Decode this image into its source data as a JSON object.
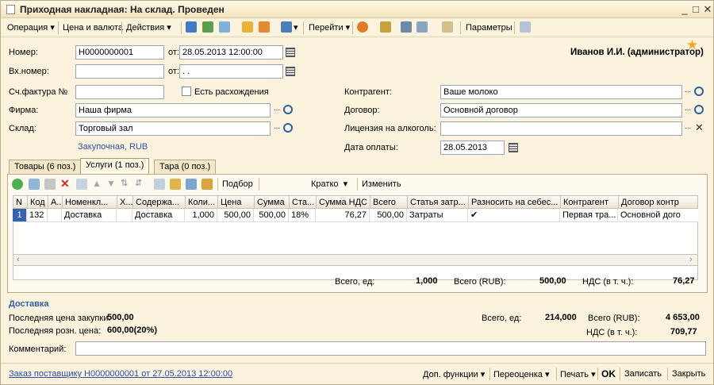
{
  "window": {
    "title": "Приходная накладная: На склад. Проведен"
  },
  "toolbar": {
    "operation": "Операция",
    "price_currency": "Цена и валюта",
    "actions": "Действия",
    "goto": "Перейти",
    "params": "Параметры"
  },
  "header": {
    "user": "Иванов И.И. (администратор)",
    "number_label": "Номер:",
    "number_value": "Н0000000001",
    "from_label": "от:",
    "date_value": "28.05.2013 12:00:00",
    "in_number_label": "Вх.номер:",
    "in_number_value": "",
    "in_from_label": "от:",
    "in_date_value": " .  .",
    "invoice_label": "Сч.фактура №",
    "invoice_value": "",
    "discrepancy_label": "Есть расхождения",
    "counterparty_label": "Контрагент:",
    "counterparty_value": "Ваше молоко",
    "firm_label": "Фирма:",
    "firm_value": "Наша фирма",
    "contract_label": "Договор:",
    "contract_value": "Основной договор",
    "warehouse_label": "Склад:",
    "warehouse_value": "Торговый зал",
    "license_label": "Лицензия на алкоголь:",
    "license_value": "",
    "price_type_link": "Закупочная, RUB",
    "pay_date_label": "Дата оплаты:",
    "pay_date_value": "28.05.2013"
  },
  "tabs": [
    {
      "label": "Товары (6 поз.)"
    },
    {
      "label": "Услуги (1 поз.)"
    },
    {
      "label": "Тара (0 поз.)"
    }
  ],
  "subtoolbar": {
    "pick": "Подбор",
    "mode": "Кратко",
    "change": "Изменить"
  },
  "grid": {
    "columns": [
      "N",
      "Код",
      "А...",
      "Номенкл...",
      "Х...",
      "Содержа...",
      "Коли...",
      "Цена",
      "Сумма",
      "Ста...",
      "Сумма НДС",
      "Всего",
      "Статья затр...",
      "Разносить на себес...",
      "Контрагент",
      "Договор контр"
    ],
    "rows": [
      [
        "1",
        "132",
        "",
        "Доставка",
        "",
        "Доставка",
        "1,000",
        "500,00",
        "500,00",
        "18%",
        "76,27",
        "500,00",
        "Затраты",
        "✔",
        "Первая тра...",
        "Основной дого"
      ]
    ]
  },
  "totals": {
    "qty_label": "Всего, ед:",
    "qty_value": "1,000",
    "sum_label": "Всего (RUB):",
    "sum_value": "500,00",
    "vat_label": "НДС (в т. ч.):",
    "vat_value": "76,27"
  },
  "info": {
    "section_title": "Доставка",
    "last_purchase_label": "Последняя цена закупки:",
    "last_purchase_value": "500,00",
    "last_retail_label": "Последняя розн. цена:",
    "last_retail_value": "600,00(20%)",
    "total_qty_label": "Всего, ед:",
    "total_qty_value": "214,000",
    "total_sum_label": "Всего (RUB):",
    "total_sum_value": "4 653,00",
    "total_vat_label": "НДС (в т. ч.):",
    "total_vat_value": "709,77",
    "comment_label": "Комментарий:",
    "comment_value": ""
  },
  "bottom": {
    "order_link": "Заказ поставщику Н0000000001 от 27.05.2013 12:00:00",
    "extra": "Доп. функции",
    "revalue": "Переоценка",
    "print": "Печать",
    "ok": "OK",
    "save": "Записать",
    "close": "Закрыть"
  }
}
